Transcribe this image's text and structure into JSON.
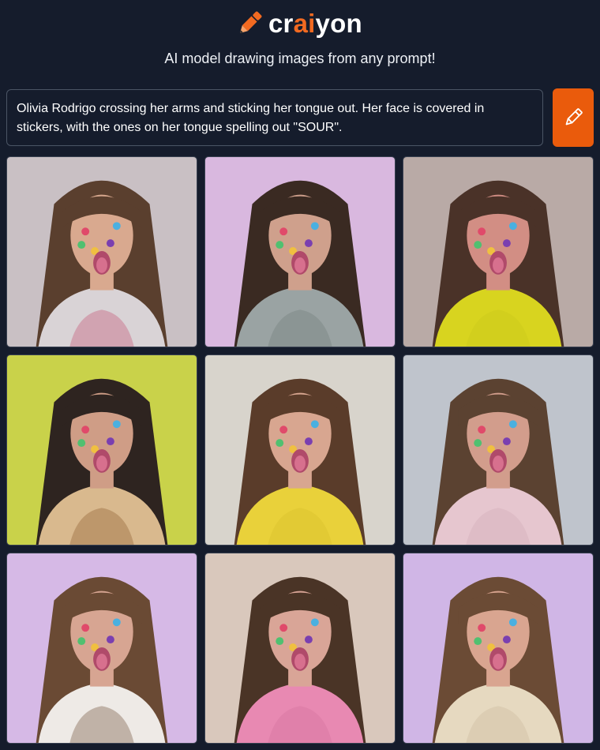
{
  "header": {
    "logo": {
      "part1": "cr",
      "part2": "ai",
      "part3": "yon",
      "icon": "pencil-icon"
    },
    "tagline": "AI model drawing images from any prompt!"
  },
  "prompt": {
    "value": "Olivia Rodrigo crossing her arms and sticking her tongue out. Her face is covered in stickers, with the ones on her tongue spelling out \"SOUR\".",
    "button_icon": "pencil-icon"
  },
  "colors": {
    "accent": "#ea5b0c",
    "background": "#151c2c",
    "border": "#4b5565"
  },
  "results": {
    "images": [
      {
        "bg": "#c9c0c4",
        "shirt": "#d9d3d6",
        "shirt2": "#c24a6e",
        "hair": "#5a3f2e",
        "skin": "#d9a98f"
      },
      {
        "bg": "#d9b8df",
        "shirt": "#9aa3a3",
        "shirt2": "#6f7a78",
        "hair": "#3a2a22",
        "skin": "#cfa08c"
      },
      {
        "bg": "#b9aaa6",
        "shirt": "#d8d41f",
        "shirt2": "#c9c51a",
        "hair": "#4a3228",
        "skin": "#d28e84"
      },
      {
        "bg": "#c9d24a",
        "shirt": "#d9b98e",
        "shirt2": "#8a5a2a",
        "hair": "#2e2420",
        "skin": "#cf9d86"
      },
      {
        "bg": "#d8d4cc",
        "shirt": "#e9d13a",
        "shirt2": "#d7bd2c",
        "hair": "#5a3c2a",
        "skin": "#d8a690"
      },
      {
        "bg": "#bfc4cc",
        "shirt": "#e6c6cf",
        "shirt2": "#cfa9b4",
        "hair": "#5b4231",
        "skin": "#d29d8c"
      },
      {
        "bg": "#d6b9e6",
        "shirt": "#eeeae6",
        "shirt2": "#6b4a32",
        "hair": "#6a4a34",
        "skin": "#d7a592"
      },
      {
        "bg": "#d9c8bc",
        "shirt": "#e889b2",
        "shirt2": "#d06f9a",
        "hair": "#4a3426",
        "skin": "#d9a597"
      },
      {
        "bg": "#d0b6e6",
        "shirt": "#e6d9c0",
        "shirt2": "#c9b89a",
        "hair": "#6b4b35",
        "skin": "#d9a590"
      }
    ]
  }
}
